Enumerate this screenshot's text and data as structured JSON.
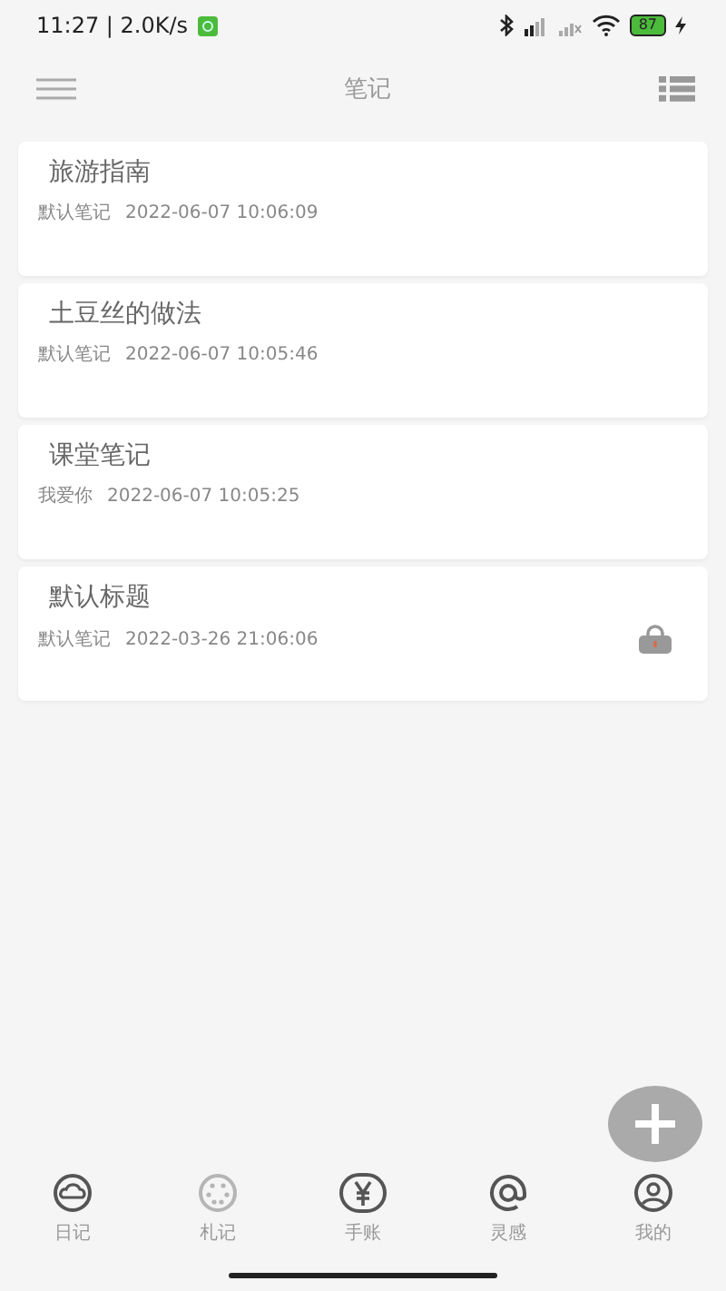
{
  "status_bar": {
    "time": "11:27 | 2.0K/s",
    "battery": "87"
  },
  "header": {
    "title": "笔记"
  },
  "notes": [
    {
      "title": "旅游指南",
      "notebook": "默认笔记",
      "date": "2022-06-07 10:06:09",
      "locked": false
    },
    {
      "title": "土豆丝的做法",
      "notebook": "默认笔记",
      "date": "2022-06-07 10:05:46",
      "locked": false
    },
    {
      "title": "课堂笔记",
      "notebook": "我爱你",
      "date": "2022-06-07 10:05:25",
      "locked": false
    },
    {
      "title": "默认标题",
      "notebook": "默认笔记",
      "date": "2022-03-26 21:06:06",
      "locked": true
    }
  ],
  "bottom_nav": [
    {
      "label": "日记",
      "kind": "cloud",
      "selected": false
    },
    {
      "label": "札记",
      "kind": "dots",
      "selected": true
    },
    {
      "label": "手账",
      "kind": "yen",
      "selected": false
    },
    {
      "label": "灵感",
      "kind": "at",
      "selected": false
    },
    {
      "label": "我的",
      "kind": "person",
      "selected": false
    }
  ]
}
